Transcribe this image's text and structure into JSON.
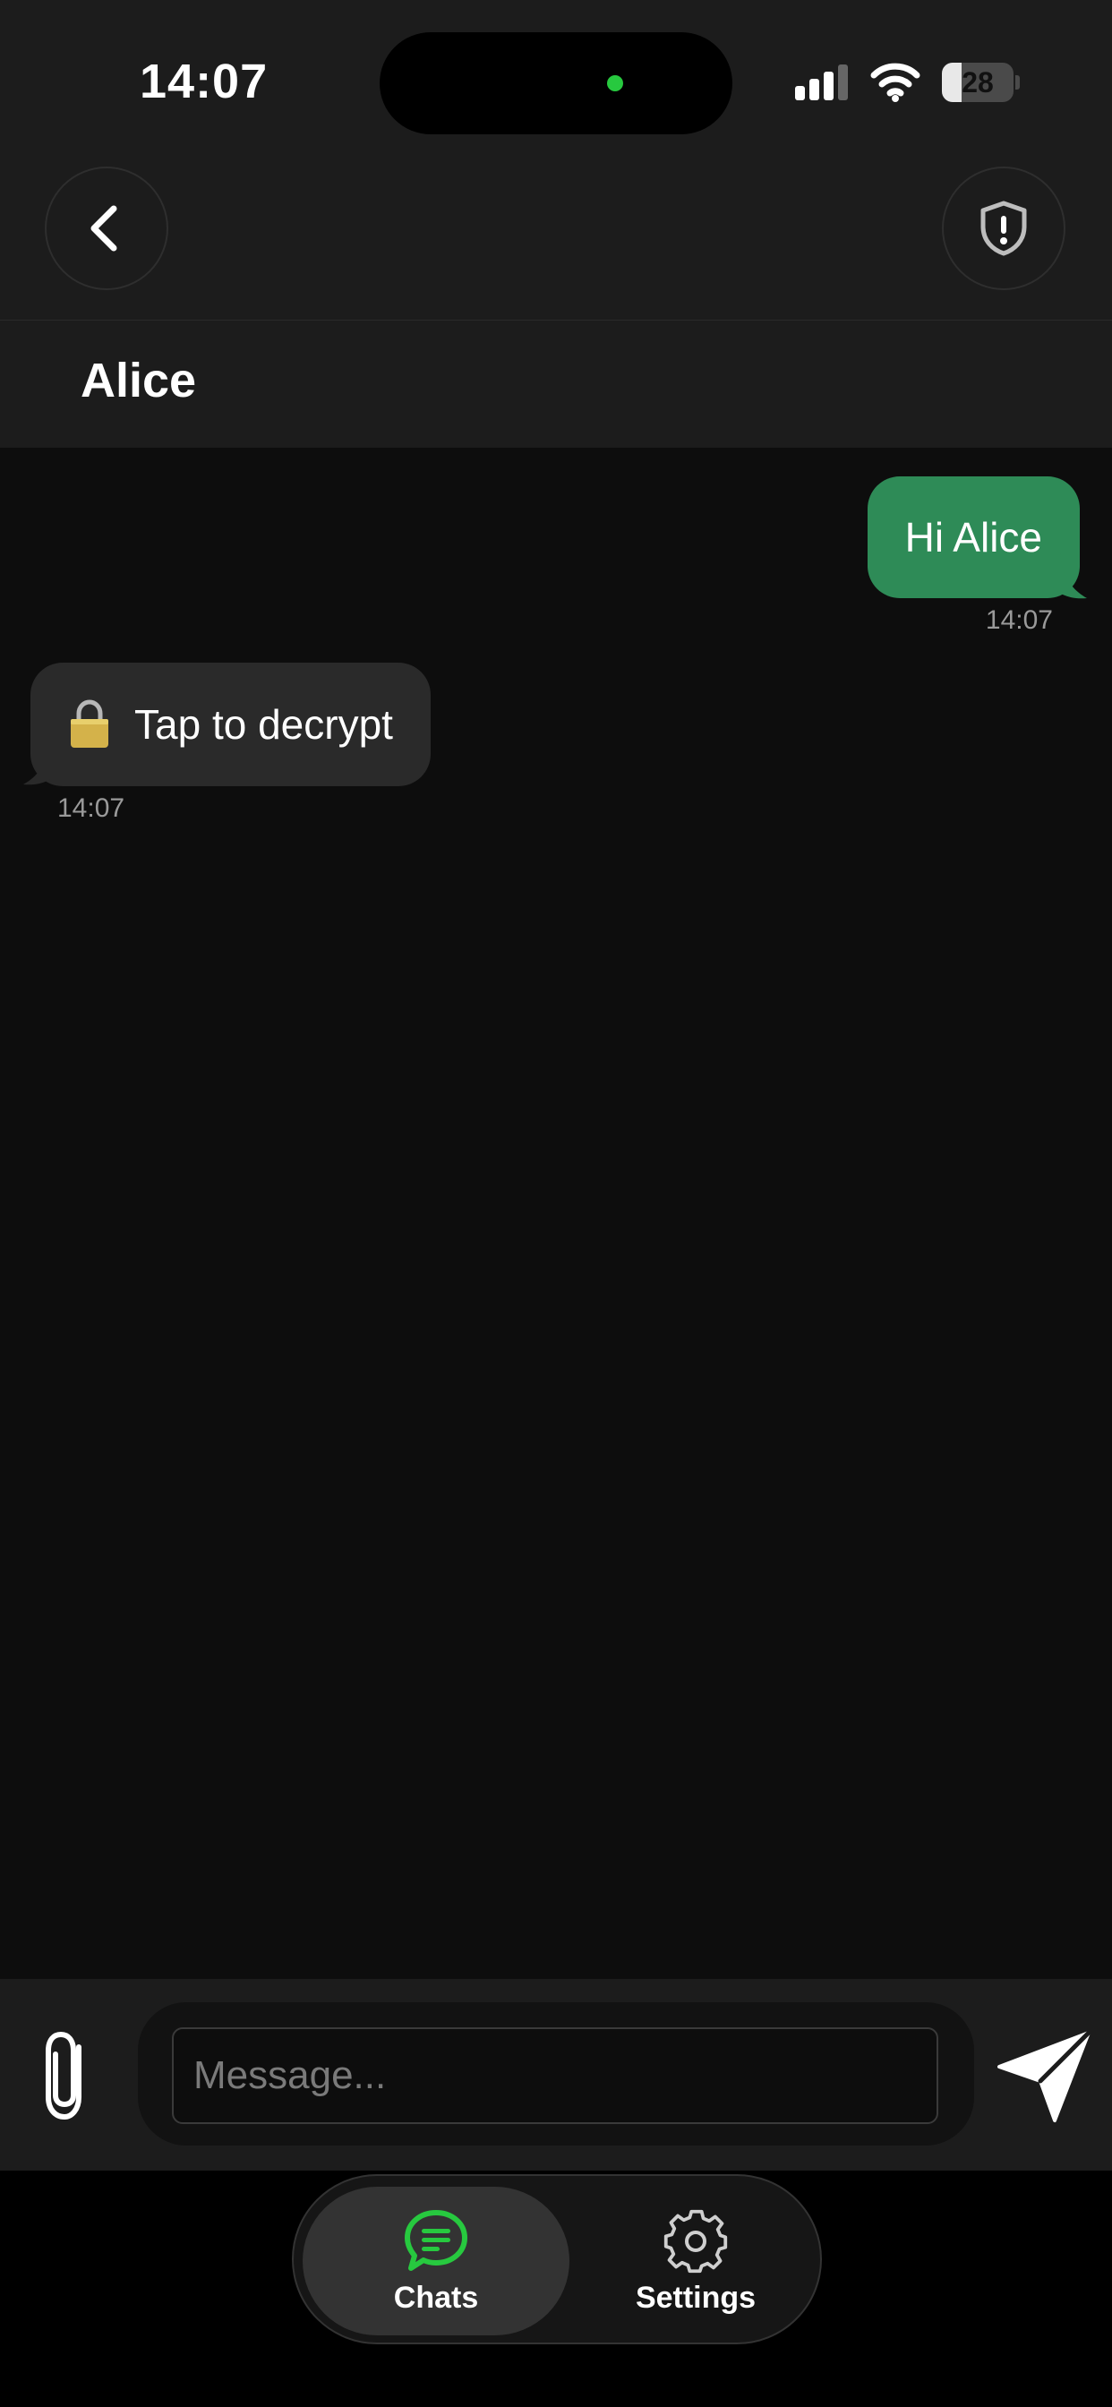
{
  "status_bar": {
    "time": "14:07",
    "battery_level": "28",
    "battery_fraction": 0.28
  },
  "nav": {
    "back_icon": "chevron-left-icon",
    "security_icon": "shield-alert-icon"
  },
  "chat": {
    "title": "Alice"
  },
  "messages": [
    {
      "direction": "outgoing",
      "text": "Hi Alice",
      "time": "14:07"
    },
    {
      "direction": "incoming",
      "text": "Tap to decrypt",
      "time": "14:07",
      "icon": "lock-icon"
    }
  ],
  "composer": {
    "placeholder": "Message...",
    "value": ""
  },
  "tabs": [
    {
      "label": "Chats",
      "icon": "chat-bubble-icon",
      "active": true
    },
    {
      "label": "Settings",
      "icon": "gear-icon",
      "active": false
    }
  ],
  "colors": {
    "accent": "#2e8b57",
    "chats_icon": "#27c93f",
    "background": "#0d0d0d",
    "surface": "#1c1c1c"
  }
}
